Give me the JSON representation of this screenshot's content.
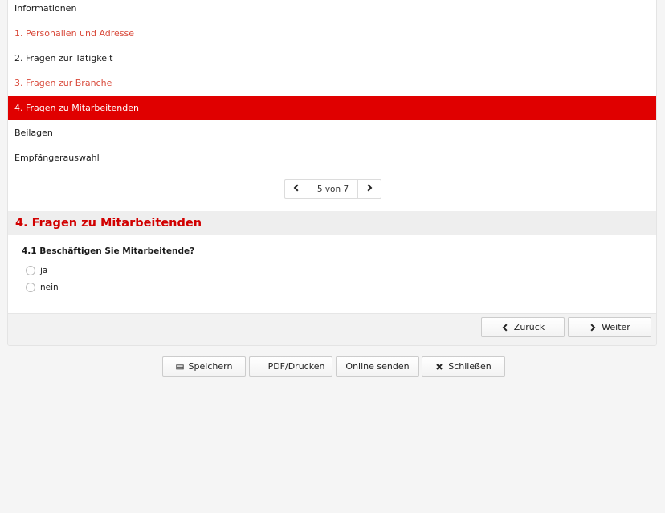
{
  "nav": {
    "items": [
      {
        "label": "Informationen",
        "state": "default"
      },
      {
        "label": "1. Personalien und Adresse",
        "state": "link"
      },
      {
        "label": "2. Fragen zur Tätigkeit",
        "state": "default"
      },
      {
        "label": "3. Fragen zur Branche",
        "state": "link"
      },
      {
        "label": "4. Fragen zu Mitarbeitenden",
        "state": "active"
      },
      {
        "label": "Beilagen",
        "state": "default"
      },
      {
        "label": "Empfängerauswahl",
        "state": "default"
      }
    ]
  },
  "pager": {
    "label": "5 von 7",
    "current": 5,
    "total": 7
  },
  "section": {
    "title": "4. Fragen zu Mitarbeitenden",
    "question": "4.1 Beschäftigen Sie Mitarbeitende?",
    "options": [
      "ja",
      "nein"
    ]
  },
  "step_buttons": {
    "back": "Zurück",
    "next": "Weiter"
  },
  "actions": {
    "save": "Speichern",
    "pdf": "PDF/Drucken",
    "send": "Online senden",
    "close": "Schließen"
  },
  "colors": {
    "accent": "#e00000",
    "link": "#d94a3b",
    "heading": "#d10000"
  },
  "icons": {
    "prev": "chevron-left-icon",
    "next": "chevron-right-icon",
    "save": "save-icon",
    "close": "close-icon"
  }
}
